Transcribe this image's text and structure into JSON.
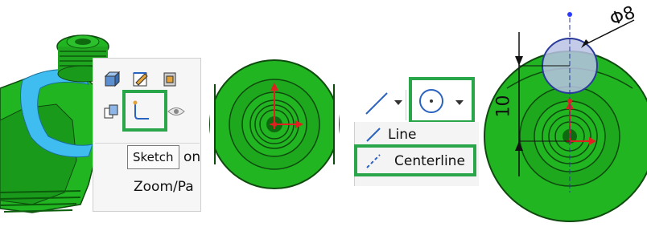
{
  "panel1": {
    "tooltip_text": "Sketch",
    "tooltip_fragment": "on",
    "zoom_menu_item": "Zoom/Pa",
    "icons": [
      "view-orientation-icon",
      "edit-sketch-icon",
      "display-style-icon",
      "normal-to-icon",
      "sketch-icon",
      "hide-show-icon"
    ]
  },
  "panel2": {
    "description": ""
  },
  "panel3": {
    "menu_items": [
      {
        "label": "Line",
        "icon": "line-tool-icon"
      },
      {
        "label": "Centerline",
        "icon": "centerline-tool-icon"
      }
    ]
  },
  "panel4": {
    "diameter_label": "Φ8",
    "vertical_dim_label": "10"
  },
  "colors": {
    "model_green": "#22b522",
    "model_dark_green": "#0e6a0e",
    "highlight_green": "#2aa64a",
    "selection_blue": "#3fbcf0",
    "axis_red": "#e02020",
    "circle_fill": "#b9c2e4"
  }
}
